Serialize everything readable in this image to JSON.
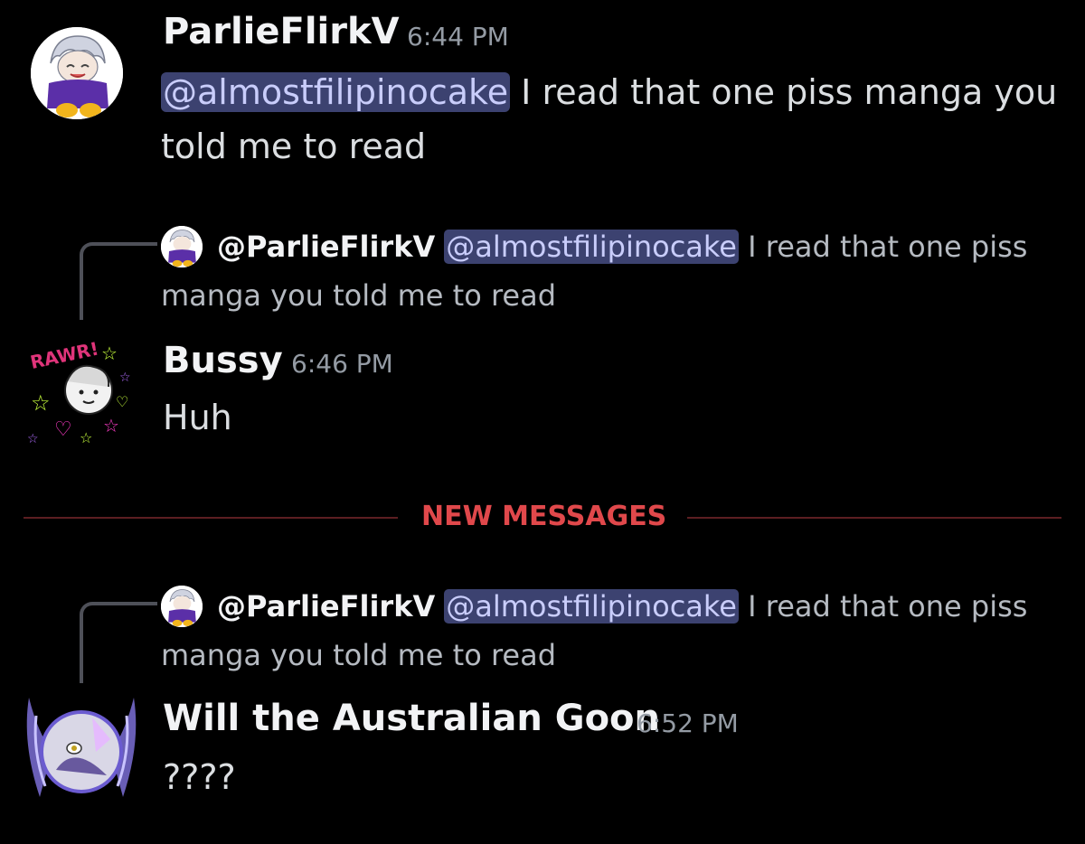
{
  "messages": [
    {
      "username": "ParlieFlirkV",
      "timestamp": "6:44 PM",
      "mention": "@almostfilipinocake",
      "text": " I read that one piss manga you told me to read"
    },
    {
      "reply": {
        "username": "@ParlieFlirkV",
        "mention": "@almostfilipinocake",
        "text": " I read that one piss manga you told me to read"
      },
      "username": "Bussy",
      "timestamp": "6:46 PM",
      "text": "Huh"
    },
    {
      "reply": {
        "username": "@ParlieFlirkV",
        "mention": "@almostfilipinocake",
        "text": " I read that one piss manga you told me to read"
      },
      "username": "Will the Australian Goon",
      "timestamp": "6:52 PM",
      "text": "????"
    }
  ],
  "divider": {
    "label": "NEW MESSAGES"
  },
  "avatar_art": {
    "bussy_text": "RAWR!"
  },
  "colors": {
    "background": "#000000",
    "mention_bg": "#3c4270",
    "mention_text": "#c9cdfb",
    "new_messages": "#e0484b",
    "timestamp": "#949ba4"
  },
  "icons": {
    "avatar_parlie": "anime-avatar-white-hair-purple-shirt",
    "avatar_bussy": "sketch-avatar-with-neon-stars",
    "avatar_will": "purple-winged-orb-avatar"
  }
}
